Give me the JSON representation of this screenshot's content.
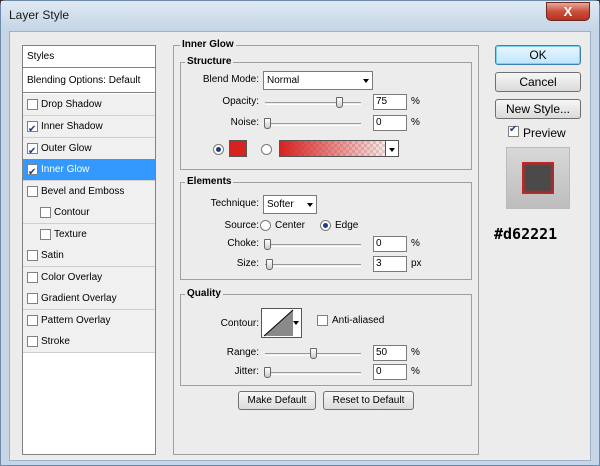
{
  "window": {
    "title": "Layer Style",
    "close_label": "X"
  },
  "left_list": {
    "header": "Styles",
    "blending": "Blending Options: Default",
    "items": [
      {
        "label": "Drop Shadow",
        "checked": false
      },
      {
        "label": "Inner Shadow",
        "checked": true
      },
      {
        "label": "Outer Glow",
        "checked": true
      },
      {
        "label": "Inner Glow",
        "checked": true,
        "selected": true
      },
      {
        "label": "Bevel and Emboss",
        "checked": false
      },
      {
        "label": "Contour",
        "checked": false
      },
      {
        "label": "Texture",
        "checked": false
      },
      {
        "label": "Satin",
        "checked": false
      },
      {
        "label": "Color Overlay",
        "checked": false
      },
      {
        "label": "Gradient Overlay",
        "checked": false
      },
      {
        "label": "Pattern Overlay",
        "checked": false
      },
      {
        "label": "Stroke",
        "checked": false
      }
    ]
  },
  "panel": {
    "title": "Inner Glow",
    "structure": {
      "title": "Structure",
      "blend_mode_label": "Blend Mode:",
      "blend_mode_value": "Normal",
      "opacity_label": "Opacity:",
      "opacity_value": "75",
      "opacity_unit": "%",
      "noise_label": "Noise:",
      "noise_value": "0",
      "noise_unit": "%",
      "color": "#d62221"
    },
    "elements": {
      "title": "Elements",
      "technique_label": "Technique:",
      "technique_value": "Softer",
      "source_label": "Source:",
      "source_center": "Center",
      "source_edge": "Edge",
      "choke_label": "Choke:",
      "choke_value": "0",
      "choke_unit": "%",
      "size_label": "Size:",
      "size_value": "3",
      "size_unit": "px"
    },
    "quality": {
      "title": "Quality",
      "contour_label": "Contour:",
      "anti_aliased": "Anti-aliased",
      "range_label": "Range:",
      "range_value": "50",
      "range_unit": "%",
      "jitter_label": "Jitter:",
      "jitter_value": "0",
      "jitter_unit": "%"
    },
    "make_default": "Make Default",
    "reset_default": "Reset to Default"
  },
  "right": {
    "ok": "OK",
    "cancel": "Cancel",
    "new_style": "New Style...",
    "preview": "Preview"
  },
  "annotation": "#d62221"
}
